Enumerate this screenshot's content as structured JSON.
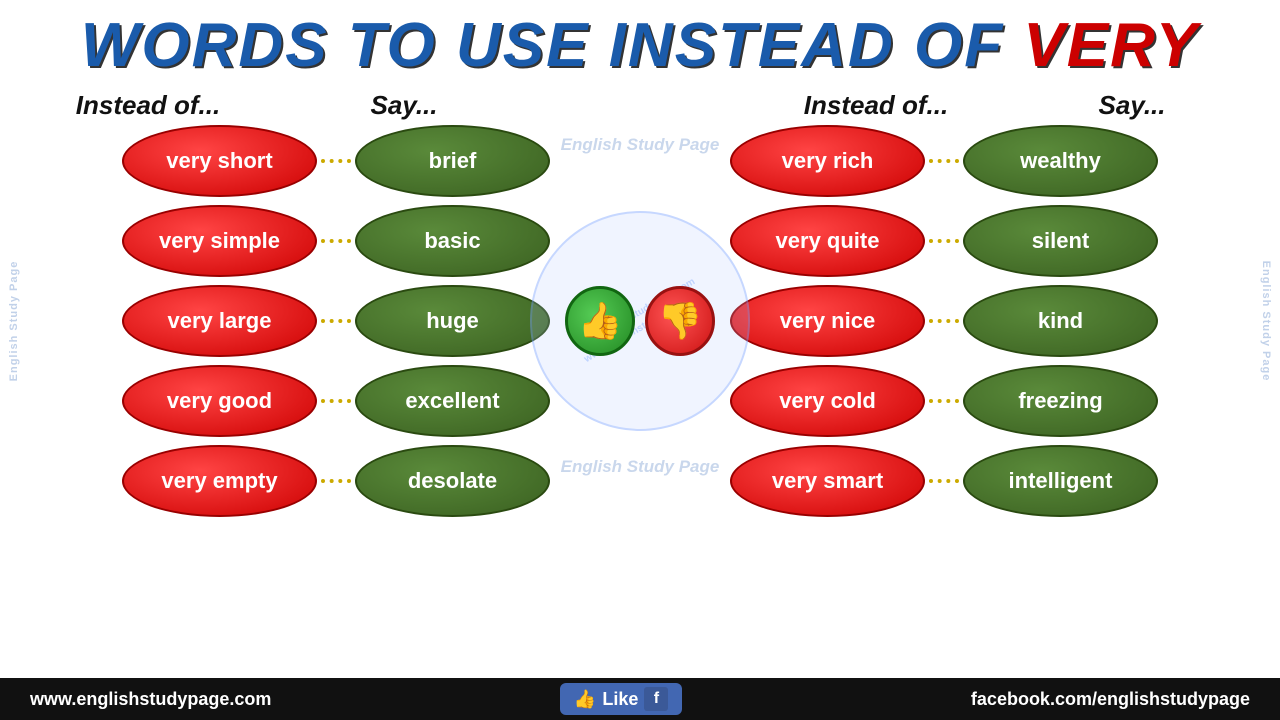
{
  "title": {
    "part1": "WORDS TO USE INSTEAD OF ",
    "part2": "VERY"
  },
  "headers": {
    "instead_of": "Instead of...",
    "say": "Say..."
  },
  "left_pairs": [
    {
      "instead": "very short",
      "say": "brief"
    },
    {
      "instead": "very simple",
      "say": "basic"
    },
    {
      "instead": "very large",
      "say": "huge"
    },
    {
      "instead": "very good",
      "say": "excellent"
    },
    {
      "instead": "very empty",
      "say": "desolate"
    }
  ],
  "right_pairs": [
    {
      "instead": "very rich",
      "say": "wealthy"
    },
    {
      "instead": "very quite",
      "say": "silent"
    },
    {
      "instead": "very nice",
      "say": "kind"
    },
    {
      "instead": "very cold",
      "say": "freezing"
    },
    {
      "instead": "very smart",
      "say": "intelligent"
    }
  ],
  "footer": {
    "website": "www.englishstudypage.com",
    "like_label": "Like",
    "facebook": "facebook.com/englishstudypage"
  },
  "watermark": {
    "center_top": "English Study Page",
    "center_bottom": "English Study Page",
    "side": "English Study Page",
    "url": "www.englishstudypage.com"
  }
}
